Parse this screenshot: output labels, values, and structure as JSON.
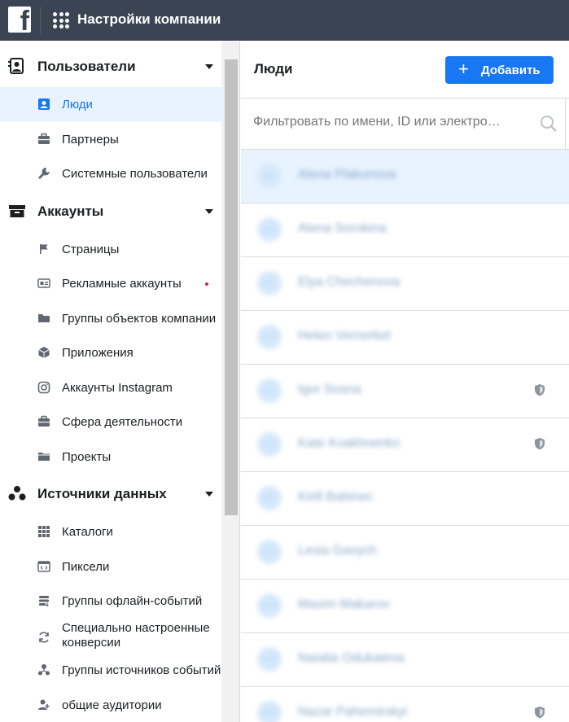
{
  "header": {
    "logo": "facebook-logo",
    "apps_icon": "apps-grid-icon",
    "title": "Настройки компании"
  },
  "sidebar": {
    "sections": [
      {
        "label": "Пользователи",
        "icon": "users-id-icon",
        "items": [
          {
            "label": "Люди",
            "icon": "person-icon",
            "active": true
          },
          {
            "label": "Партнеры",
            "icon": "briefcase-icon"
          },
          {
            "label": "Системные пользователи",
            "icon": "wrench-icon"
          }
        ]
      },
      {
        "label": "Аккаунты",
        "icon": "archive-box-icon",
        "items": [
          {
            "label": "Страницы",
            "icon": "flag-icon"
          },
          {
            "label": "Рекламные аккаунты",
            "icon": "ad-account-icon",
            "alert": true
          },
          {
            "label": "Группы объектов компании",
            "icon": "folder-icon"
          },
          {
            "label": "Приложения",
            "icon": "cube-icon"
          },
          {
            "label": "Аккаунты Instagram",
            "icon": "instagram-icon"
          },
          {
            "label": "Сфера деятельности",
            "icon": "briefcase-icon"
          },
          {
            "label": "Проекты",
            "icon": "project-folder-icon"
          }
        ]
      },
      {
        "label": "Источники данных",
        "icon": "data-sources-icon",
        "items": [
          {
            "label": "Каталоги",
            "icon": "catalog-grid-icon"
          },
          {
            "label": "Пиксели",
            "icon": "pixel-code-icon"
          },
          {
            "label": "Группы офлайн-событий",
            "icon": "offline-events-icon"
          },
          {
            "label": "Специально настроенные конверсии",
            "icon": "refresh-icon"
          },
          {
            "label": "Группы источников событий",
            "icon": "event-sources-icon"
          },
          {
            "label": "общие аудитории",
            "icon": "shared-audience-icon"
          }
        ]
      }
    ]
  },
  "main": {
    "title": "Люди",
    "add_button": {
      "label": "Добавить",
      "icon": "plus-icon"
    },
    "filter": {
      "placeholder": "Фильтровать по имени, ID или электро…",
      "icon": "search-icon"
    },
    "people": [
      {
        "initials": "AP",
        "name": "Alena Plakunova",
        "selected": true,
        "admin": false
      },
      {
        "initials": "AS",
        "name": "Alena Sorokina",
        "admin": false
      },
      {
        "initials": "EC",
        "name": "Elya Chechenova",
        "admin": false
      },
      {
        "initials": "HV",
        "name": "Helen Vernerkel",
        "admin": false
      },
      {
        "initials": "IS",
        "name": "Igor Sosna",
        "admin": true
      },
      {
        "initials": "KK",
        "name": "Kate Kvakhnenko",
        "admin": true
      },
      {
        "initials": "KB",
        "name": "Kirill Babinec",
        "admin": false
      },
      {
        "initials": "LG",
        "name": "Lesia Gavych",
        "admin": false
      },
      {
        "initials": "MM",
        "name": "Maxim Makarov",
        "admin": false
      },
      {
        "initials": "NO",
        "name": "Natalia Odukaieva",
        "admin": false
      },
      {
        "initials": "NP",
        "name": "Nazar Pahemirskyi",
        "admin": true
      }
    ]
  }
}
